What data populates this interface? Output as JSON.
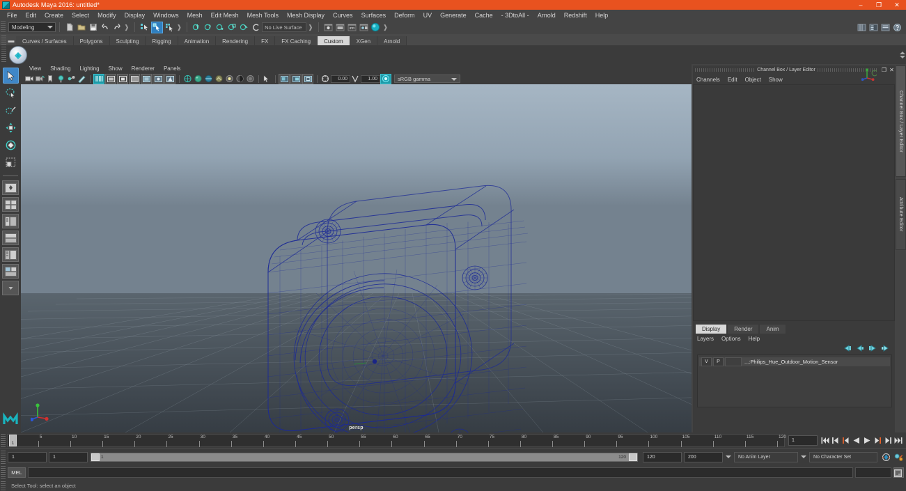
{
  "window": {
    "title": "Autodesk Maya 2016: untitled*",
    "app_icon": "maya-icon",
    "minimize": "–",
    "maximize": "❐",
    "close": "✕",
    "accent_color": "#e8521f"
  },
  "menubar": {
    "items": [
      "File",
      "Edit",
      "Create",
      "Select",
      "Modify",
      "Display",
      "Windows",
      "Mesh",
      "Edit Mesh",
      "Mesh Tools",
      "Mesh Display",
      "Curves",
      "Surfaces",
      "Deform",
      "UV",
      "Generate",
      "Cache",
      "- 3DtoAll -",
      "Arnold",
      "Redshift",
      "Help"
    ]
  },
  "toolbar": {
    "mode_selector": "Modeling",
    "live_surface": "No Live Surface",
    "file_icons": [
      "new-scene-icon",
      "open-scene-icon",
      "save-scene-icon",
      "undo-icon",
      "redo-icon"
    ],
    "select_mode_icons": [
      "select-by-hierarchy-icon",
      "select-by-object-icon",
      "select-by-component-icon"
    ],
    "snap_icons": [
      "snap-to-grid-icon",
      "snap-to-curve-icon",
      "snap-to-point-icon",
      "snap-to-projected-center-icon",
      "snap-to-view-plane-icon",
      "make-live-icon"
    ],
    "render_icons": [
      "render-current-frame-icon",
      "render-sequence-icon",
      "ipr-render-icon",
      "render-settings-icon",
      "hypershade-icon"
    ],
    "right_icons": [
      "sidebar-attribute-editor-icon",
      "sidebar-tool-settings-icon",
      "sidebar-channel-box-icon",
      "help-icon"
    ]
  },
  "shelf": {
    "tabs": [
      "Curves / Surfaces",
      "Polygons",
      "Sculpting",
      "Rigging",
      "Animation",
      "Rendering",
      "FX",
      "FX Caching",
      "Custom",
      "XGen",
      "Arnold"
    ],
    "active_tab": "Custom",
    "buttons": [
      {
        "name": "custom-shelf-button",
        "glyph": "◈"
      }
    ]
  },
  "toolbox": {
    "tools": [
      {
        "name": "select-tool",
        "glyph": "➤",
        "active": true
      },
      {
        "name": "lasso-select-tool",
        "glyph": "◌",
        "active": false
      },
      {
        "name": "paint-select-tool",
        "glyph": "✎",
        "active": false
      },
      {
        "name": "move-tool",
        "glyph": "✥",
        "active": false
      },
      {
        "name": "rotate-tool",
        "glyph": "◎",
        "active": false
      },
      {
        "name": "scale-tool",
        "glyph": "⬚",
        "active": false
      }
    ],
    "layout_presets": [
      "single-perspective-layout",
      "four-view-layout",
      "persp-outliner-layout",
      "persp-graph-editor-layout",
      "hypershade-persp-layout",
      "persp-render-layout",
      "persp-uv-editor-layout",
      "more-layouts"
    ]
  },
  "viewport": {
    "menus": [
      "View",
      "Shading",
      "Lighting",
      "Show",
      "Renderer",
      "Panels"
    ],
    "camera_label": "persp",
    "exposure": "0.00",
    "gamma": "1.00",
    "color_management": "sRGB gamma",
    "icons_left": [
      "select-camera-icon",
      "camera-attributes-icon",
      "bookmark-icon",
      "image-plane-icon",
      "twopoint-icon",
      "grease-pencil-icon"
    ],
    "icons_display": [
      "grid-toggle-icon",
      "film-gate-icon",
      "resolution-gate-icon",
      "gate-mask-icon",
      "xray-toggle-icon",
      "xray-joints-icon",
      "xray-active-icon"
    ],
    "icons_shading": [
      "wireframe-shading-icon",
      "smooth-shading-icon",
      "smooth-wireframe-icon",
      "hw-texture-icon",
      "use-all-lights-icon",
      "shadows-icon",
      "screen-space-ao-icon",
      "motion-blur-icon",
      "multisample-icon",
      "depth-of-field-icon"
    ],
    "icons_isolate": [
      "isolate-select-icon",
      "xray-mode-icon",
      "xray-components-icon"
    ],
    "axis_gizmo": "view-axis-gizmo",
    "model": {
      "name": "Philips_Hue_Outdoor_Motion_Sensor",
      "display": "wireframe",
      "wire_color": "#1e2b9e"
    }
  },
  "channel_box": {
    "panel_title": "Channel Box / Layer Editor",
    "menus": [
      "Channels",
      "Edit",
      "Object",
      "Show"
    ],
    "undock_glyph": "❐",
    "close_glyph": "✕",
    "axis_icon": "manipulator-axis-icon"
  },
  "layer_editor": {
    "tabs": [
      "Display",
      "Render",
      "Anim"
    ],
    "active_tab": "Display",
    "menus": [
      "Layers",
      "Options",
      "Help"
    ],
    "buttons": [
      "move-layer-up-icon",
      "move-layer-down-icon",
      "new-layer-icon",
      "new-layer-from-selected-icon"
    ],
    "layers": [
      {
        "visibility": "V",
        "playback": "P",
        "color_swatch": "",
        "name": "...:Philips_Hue_Outdoor_Motion_Sensor"
      }
    ]
  },
  "side_tabs": [
    {
      "label": "Channel Box / Layer Editor",
      "active": true
    },
    {
      "label": "Attribute Editor",
      "active": false
    }
  ],
  "timeline": {
    "start": 1,
    "end": 120,
    "current_frame": "1",
    "tick_labels": [
      "5",
      "10",
      "15",
      "20",
      "25",
      "30",
      "35",
      "40",
      "45",
      "50",
      "55",
      "60",
      "65",
      "70",
      "75",
      "80",
      "85",
      "90",
      "95",
      "100",
      "105",
      "110",
      "115",
      "120"
    ],
    "playback_buttons": [
      "go-to-start-icon",
      "step-back-keyframe-icon",
      "step-back-frame-icon",
      "play-backwards-icon",
      "play-forwards-icon",
      "step-forward-frame-icon",
      "step-forward-keyframe-icon",
      "go-to-end-icon"
    ]
  },
  "range_slider": {
    "anim_start": "1",
    "range_start": "1",
    "slider_value": "1",
    "slider_end": "120",
    "range_end": "120",
    "anim_end": "200",
    "anim_layer": "No Anim Layer",
    "character_set": "No Character Set",
    "auto_key_icon": "auto-keyframe-icon",
    "anim_prefs_icon": "animation-preferences-icon"
  },
  "command_line": {
    "language": "MEL",
    "value": "",
    "script_editor_icon": "script-editor-icon"
  },
  "help_line": {
    "text": "Select Tool: select an object"
  }
}
